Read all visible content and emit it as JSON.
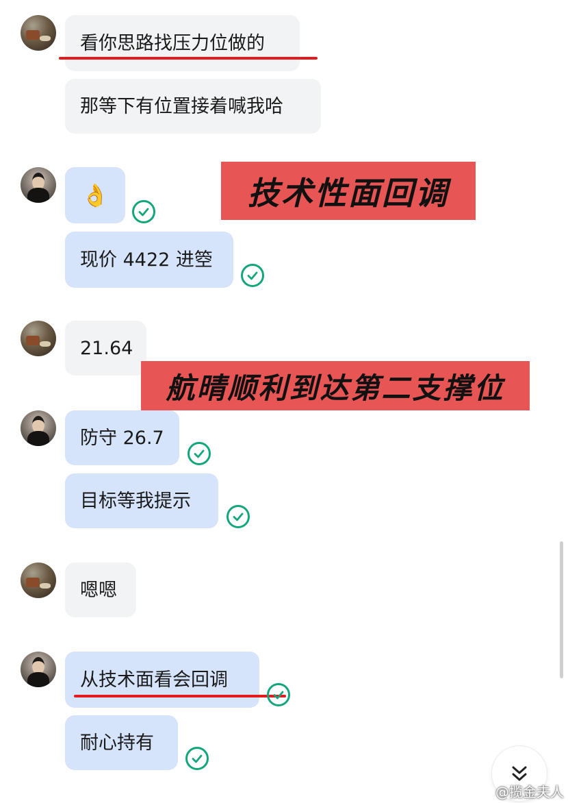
{
  "messages": {
    "m1": "看你思路找压力位做的",
    "m2": "那等下有位置接着喊我哈",
    "m3": "👌",
    "m4": "现价 4422 进箜",
    "m5": "21.64",
    "m6": "防守 26.7",
    "m7": "目标等我提示",
    "m8": "嗯嗯",
    "m9": "从技术面看会回调",
    "m10": "耐心持有"
  },
  "banners": {
    "b1": "技术性面回调",
    "b2": "航晴顺利到达第二支撑位"
  },
  "watermark": "@揽金夫人",
  "icons": {
    "read_receipt": "check-circle-icon",
    "scroll_down": "double-chevron-down-icon",
    "watermark": "weibo-icon"
  },
  "colors": {
    "incoming_bubble": "#f2f3f5",
    "outgoing_bubble": "#d5e3fb",
    "check": "#13a57c",
    "banner": "#e85555",
    "underline": "#e21c1c"
  }
}
